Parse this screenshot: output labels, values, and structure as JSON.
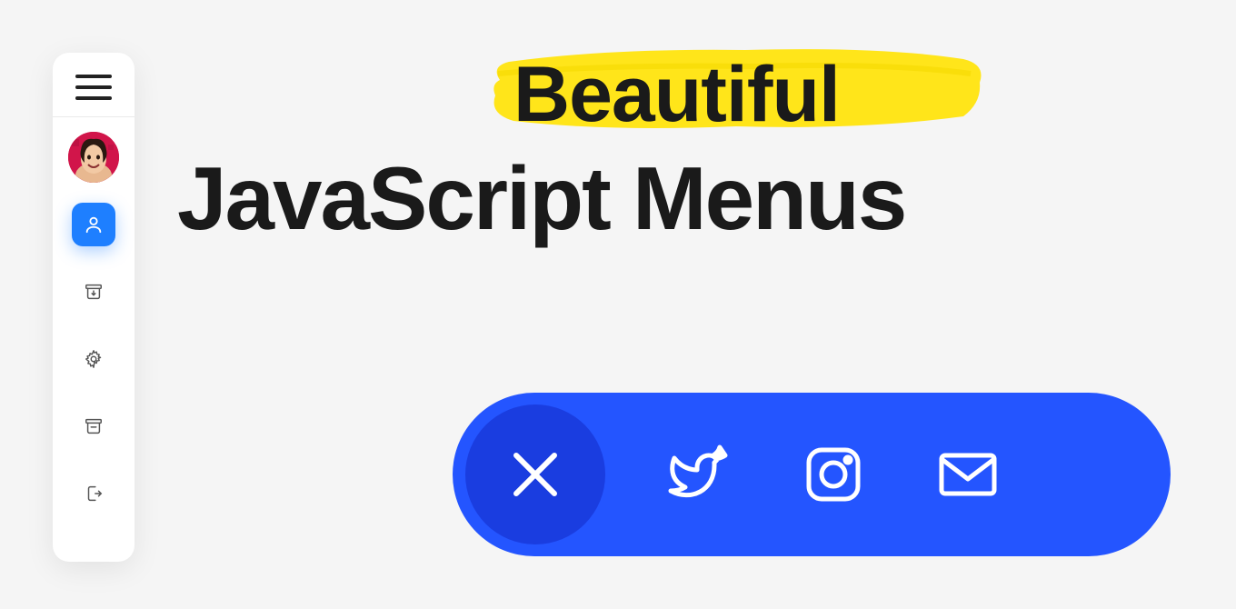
{
  "title": {
    "highlight": "Beautiful",
    "main": "JavaScript Menus"
  },
  "sidebar": {
    "items": [
      {
        "name": "hamburger-icon",
        "type": "hamburger"
      },
      {
        "name": "avatar",
        "type": "avatar"
      },
      {
        "name": "user-icon",
        "type": "user",
        "active": true
      },
      {
        "name": "archive-icon",
        "type": "archive"
      },
      {
        "name": "settings-icon",
        "type": "settings"
      },
      {
        "name": "archive2-icon",
        "type": "archive"
      },
      {
        "name": "logout-icon",
        "type": "logout"
      }
    ]
  },
  "social": {
    "items": [
      {
        "name": "close-icon",
        "type": "close"
      },
      {
        "name": "twitter-icon",
        "type": "twitter"
      },
      {
        "name": "instagram-icon",
        "type": "instagram"
      },
      {
        "name": "mail-icon",
        "type": "mail"
      }
    ]
  },
  "colors": {
    "accent": "#2455ff",
    "accentDark": "#1a3de0",
    "highlight": "#ffe51a",
    "sidebarActive": "#1e7fff"
  }
}
